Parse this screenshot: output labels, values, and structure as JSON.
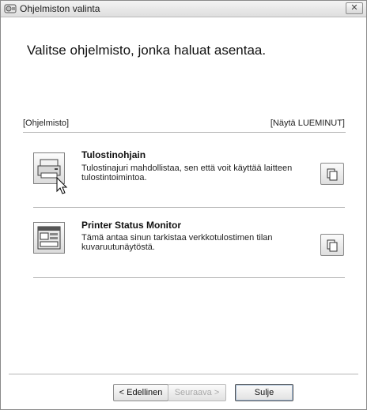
{
  "window": {
    "title": "Ohjelmiston valinta",
    "close_glyph": "✕",
    "app_icon": "software-setup-icon"
  },
  "heading": "Valitse ohjelmisto, jonka haluat asentaa.",
  "section": {
    "left_label": "[Ohjelmisto]",
    "right_label": "[Näytä LUEMINUT]"
  },
  "items": [
    {
      "title": "Tulostinohjain",
      "description": "Tulostinajuri mahdollistaa, sen että voit käyttää laitteen tulostintoimintoa.",
      "icon": "printer-icon",
      "readme_icon": "document-icon"
    },
    {
      "title": "Printer Status Monitor",
      "description": "Tämä antaa sinun tarkistaa verkkotulostimen tilan kuvaruutunäytöstä.",
      "icon": "status-monitor-icon",
      "readme_icon": "document-icon"
    }
  ],
  "footer": {
    "back_label": "< Edellinen",
    "next_label": "Seuraava >",
    "close_label": "Sulje"
  }
}
